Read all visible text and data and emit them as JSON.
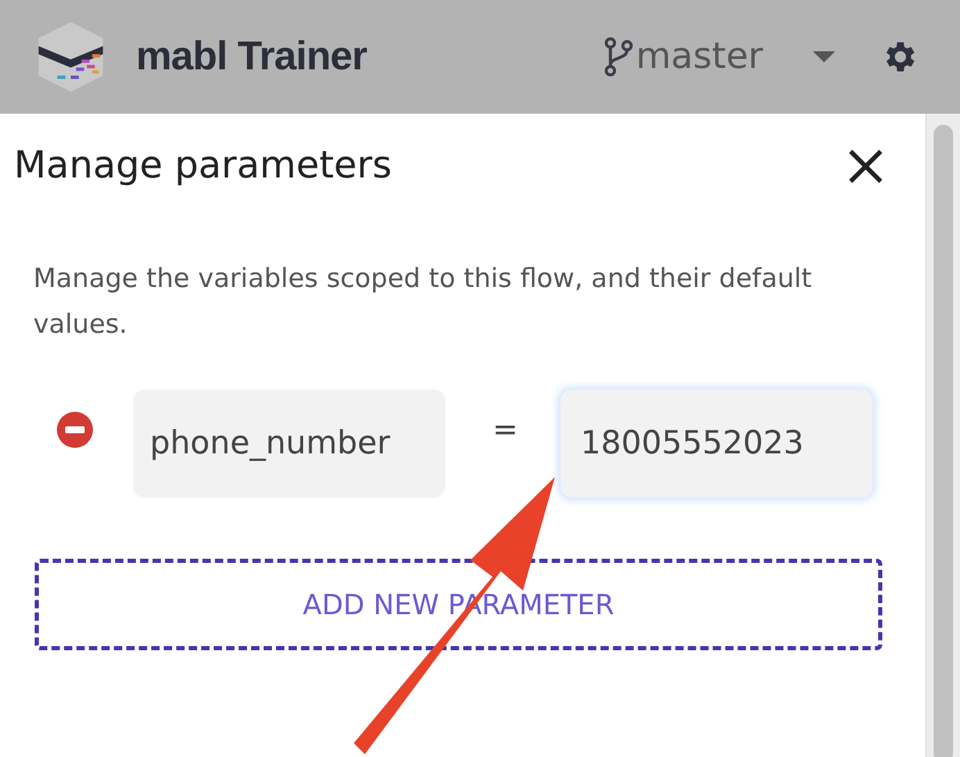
{
  "header": {
    "title": "mabl Trainer",
    "branch": "master"
  },
  "panel": {
    "title": "Manage parameters",
    "description": "Manage the variables scoped to this flow, and their default values.",
    "parameters": [
      {
        "name": "phone_number",
        "equals": "=",
        "value": "18005552023",
        "focused": true
      }
    ],
    "add_button": "ADD NEW PARAMETER"
  }
}
